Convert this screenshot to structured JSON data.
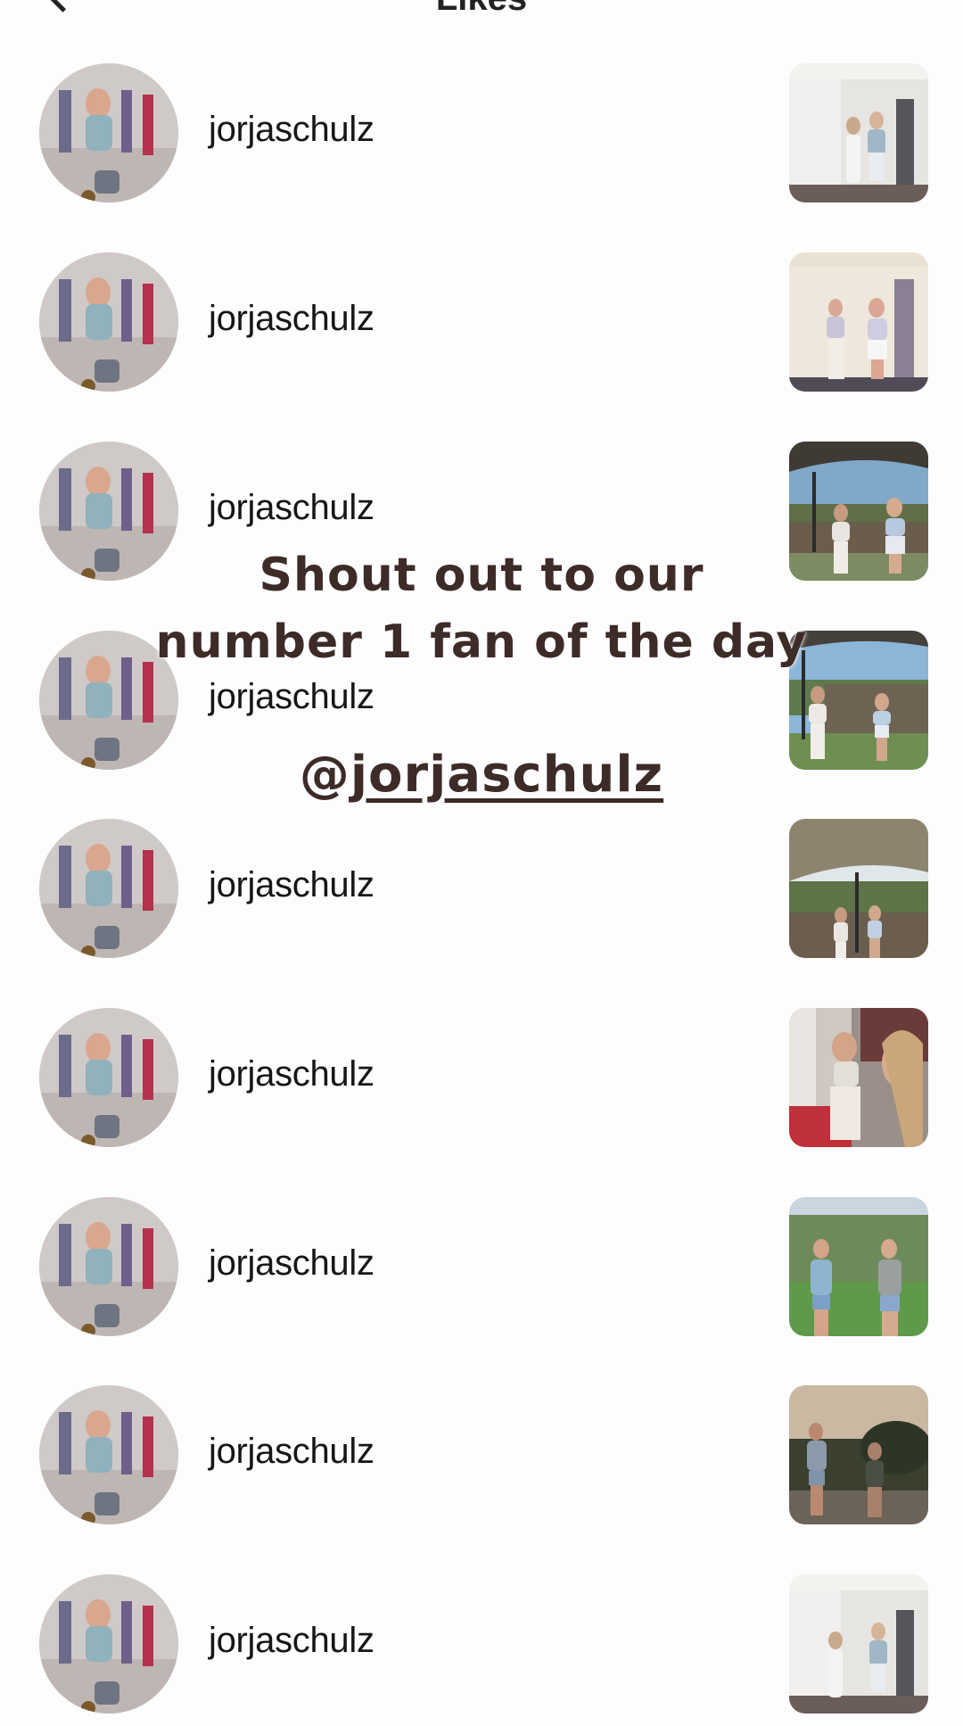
{
  "header": {
    "title": "Likes"
  },
  "likes": [
    {
      "username": "jorjaschulz",
      "thumb": "indoor-two"
    },
    {
      "username": "jorjaschulz",
      "thumb": "indoor-two"
    },
    {
      "username": "jorjaschulz",
      "thumb": "outdoor-tent"
    },
    {
      "username": "jorjaschulz",
      "thumb": "outdoor-fence"
    },
    {
      "username": "jorjaschulz",
      "thumb": "outdoor-tent"
    },
    {
      "username": "jorjaschulz",
      "thumb": "indoor-closeup"
    },
    {
      "username": "jorjaschulz",
      "thumb": "park-trees"
    },
    {
      "username": "jorjaschulz",
      "thumb": "dusk-street"
    },
    {
      "username": "jorjaschulz",
      "thumb": "indoor-two"
    }
  ],
  "overlay": {
    "line1": "Shout out to our",
    "line2": "number 1 fan of the day",
    "handle_at": "@",
    "handle_name": "jorjaschulz"
  }
}
